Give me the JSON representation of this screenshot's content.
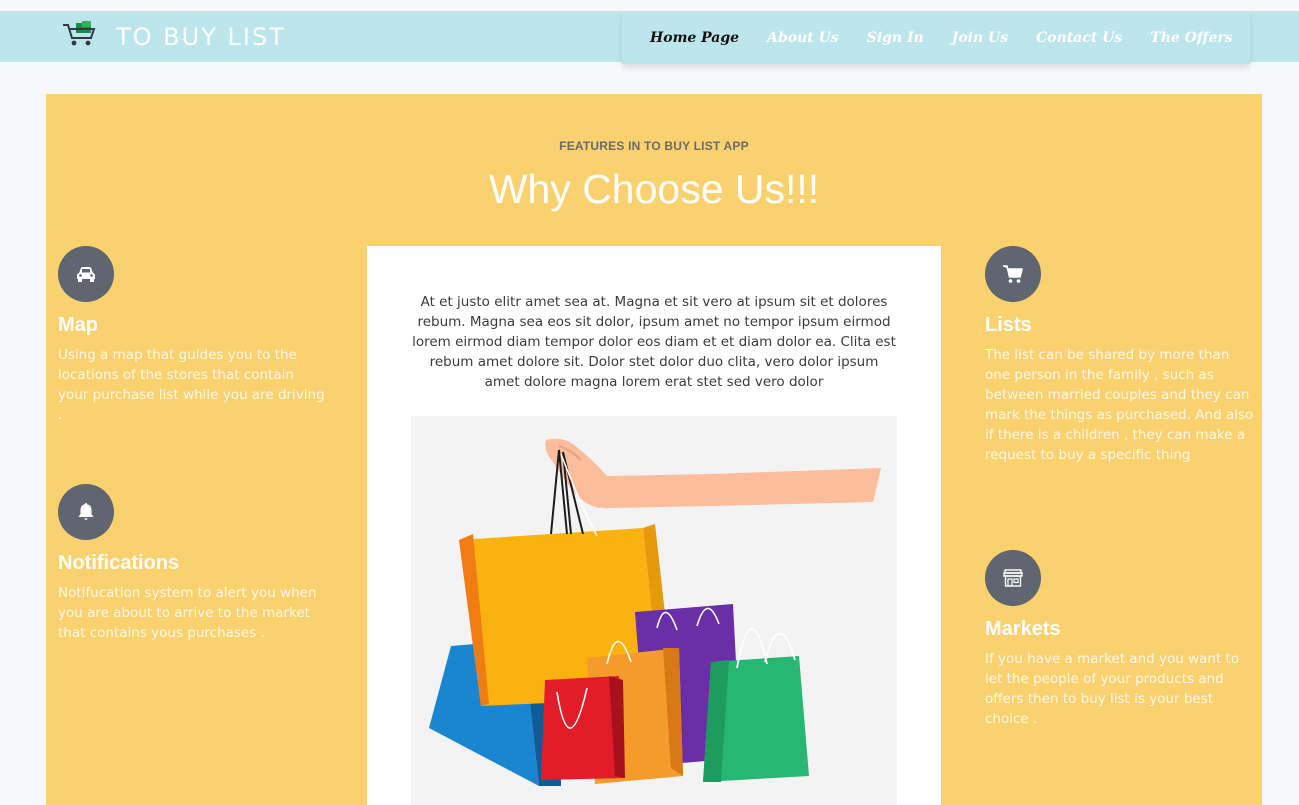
{
  "brand": {
    "name": "TO BUY LIST",
    "icon": "shopping-cart-icon"
  },
  "nav": {
    "items": [
      {
        "label": "Home Page",
        "active": true
      },
      {
        "label": "About Us",
        "active": false
      },
      {
        "label": "Sign In",
        "active": false
      },
      {
        "label": "Join Us",
        "active": false
      },
      {
        "label": "Contact Us",
        "active": false
      },
      {
        "label": "The Offers",
        "active": false
      }
    ]
  },
  "section": {
    "eyebrow": "FEATURES IN TO BUY LIST APP",
    "title": "Why Choose Us!!!"
  },
  "features": {
    "left": [
      {
        "title": "Map",
        "icon": "car-icon",
        "text": "Using a map that guides you to the locations of the stores that contain your purchase list while you are driving ."
      },
      {
        "title": "Notifications",
        "icon": "bell-icon",
        "text": "Notifucation system to alert you when you are about to arrive to the market that contains yous purchases ."
      }
    ],
    "right": [
      {
        "title": "Lists",
        "icon": "cart-icon",
        "text": "The list can be shared by more than one person in the family , such as between married couples and they can mark the things as purchased. And also if there is a children , they can make a request to buy a specific thing"
      },
      {
        "title": "Markets",
        "icon": "store-icon",
        "text": "If you have a market and you want to let the people of your products and offers then to buy list is your best choice ."
      }
    ]
  },
  "card": {
    "text": "At et justo elitr amet sea at. Magna et sit vero at ipsum sit et dolores rebum. Magna sea eos sit dolor, ipsum amet no tempor ipsum eirmod lorem eirmod diam tempor dolor eos diam et et diam dolor ea. Clita est rebum amet dolore sit. Dolor stet dolor duo clita, vero dolor ipsum amet dolore magna lorem erat stet sed vero dolor",
    "image": "shopping-bags-illustration"
  },
  "colors": {
    "topbar": "#bde5ec",
    "panel": "#fad16f",
    "icon_circle": "#5f6670",
    "active_nav": "#111111"
  }
}
